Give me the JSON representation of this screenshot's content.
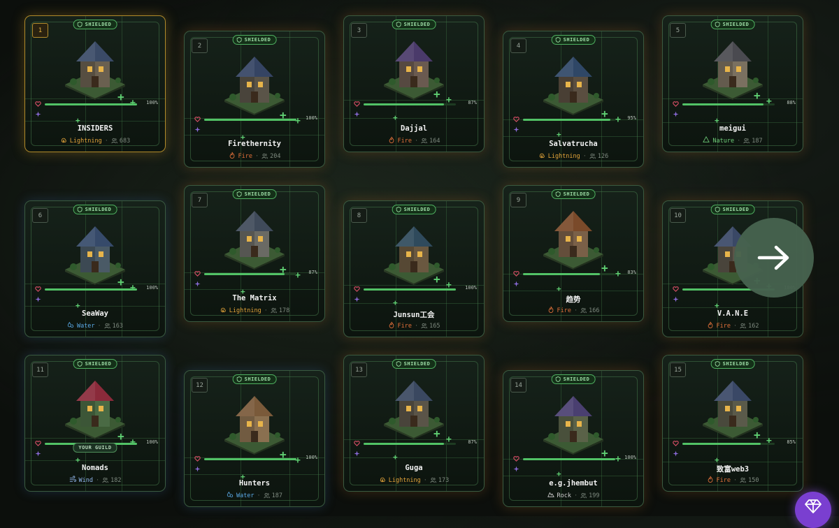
{
  "shield_label": "SHIELDED",
  "your_guild_label": "YOUR GUILD",
  "cards": [
    {
      "rank": "1",
      "name": "INSIDERS",
      "element": "Lightning",
      "element_icon": "lightning-icon",
      "members": "683",
      "hp": "100%",
      "hp_value": 1.0,
      "shielded": true,
      "your_guild": false
    },
    {
      "rank": "2",
      "name": "Firethernity",
      "element": "Fire",
      "element_icon": "fire-icon",
      "members": "204",
      "hp": "100%",
      "hp_value": 1.0,
      "shielded": true,
      "your_guild": false
    },
    {
      "rank": "3",
      "name": "Dajjal",
      "element": "Fire",
      "element_icon": "fire-icon",
      "members": "164",
      "hp": "87%",
      "hp_value": 0.87,
      "shielded": true,
      "your_guild": false
    },
    {
      "rank": "4",
      "name": "Salvatrucha",
      "element": "Lightning",
      "element_icon": "lightning-icon",
      "members": "126",
      "hp": "95%",
      "hp_value": 0.95,
      "shielded": true,
      "your_guild": false
    },
    {
      "rank": "5",
      "name": "meigui",
      "element": "Nature",
      "element_icon": "nature-icon",
      "members": "187",
      "hp": "88%",
      "hp_value": 0.88,
      "shielded": true,
      "your_guild": false
    },
    {
      "rank": "6",
      "name": "SeaWay",
      "element": "Water",
      "element_icon": "water-icon",
      "members": "163",
      "hp": "100%",
      "hp_value": 1.0,
      "shielded": true,
      "your_guild": false
    },
    {
      "rank": "7",
      "name": "The Matrix",
      "element": "Lightning",
      "element_icon": "lightning-icon",
      "members": "178",
      "hp": "87%",
      "hp_value": 0.87,
      "shielded": true,
      "your_guild": false
    },
    {
      "rank": "8",
      "name": "Junsun工会",
      "element": "Fire",
      "element_icon": "fire-icon",
      "members": "165",
      "hp": "100%",
      "hp_value": 1.0,
      "shielded": true,
      "your_guild": false
    },
    {
      "rank": "9",
      "name": "趋势",
      "element": "Fire",
      "element_icon": "fire-icon",
      "members": "166",
      "hp": "83%",
      "hp_value": 0.83,
      "shielded": true,
      "your_guild": false
    },
    {
      "rank": "10",
      "name": "V.A.N.E",
      "element": "Fire",
      "element_icon": "fire-icon",
      "members": "162",
      "hp": "100%",
      "hp_value": 1.0,
      "shielded": true,
      "your_guild": false
    },
    {
      "rank": "11",
      "name": "Nomads",
      "element": "Wind",
      "element_icon": "wind-icon",
      "members": "182",
      "hp": "100%",
      "hp_value": 1.0,
      "shielded": true,
      "your_guild": true
    },
    {
      "rank": "12",
      "name": "Hunters",
      "element": "Water",
      "element_icon": "water-icon",
      "members": "187",
      "hp": "100%",
      "hp_value": 1.0,
      "shielded": true,
      "your_guild": false
    },
    {
      "rank": "13",
      "name": "Guga",
      "element": "Lightning",
      "element_icon": "lightning-icon",
      "members": "173",
      "hp": "87%",
      "hp_value": 0.87,
      "shielded": true,
      "your_guild": false
    },
    {
      "rank": "14",
      "name": "e.g.jhembut",
      "element": "Rock",
      "element_icon": "rock-icon",
      "members": "199",
      "hp": "100%",
      "hp_value": 1.0,
      "shielded": true,
      "your_guild": false
    },
    {
      "rank": "15",
      "name": "致富web3",
      "element": "Fire",
      "element_icon": "fire-icon",
      "members": "150",
      "hp": "85%",
      "hp_value": 0.85,
      "shielded": true,
      "your_guild": false
    }
  ],
  "element_colors": {
    "Lightning": "#e3a43a",
    "Fire": "#e0703a",
    "Nature": "#6fcf7a",
    "Water": "#5aa9e6",
    "Wind": "#8fb4e8",
    "Rock": "#cfcfcf"
  },
  "accent_green": "#52c266",
  "next_button_icon": "arrow-right-icon",
  "gem_button_icon": "gem-icon"
}
